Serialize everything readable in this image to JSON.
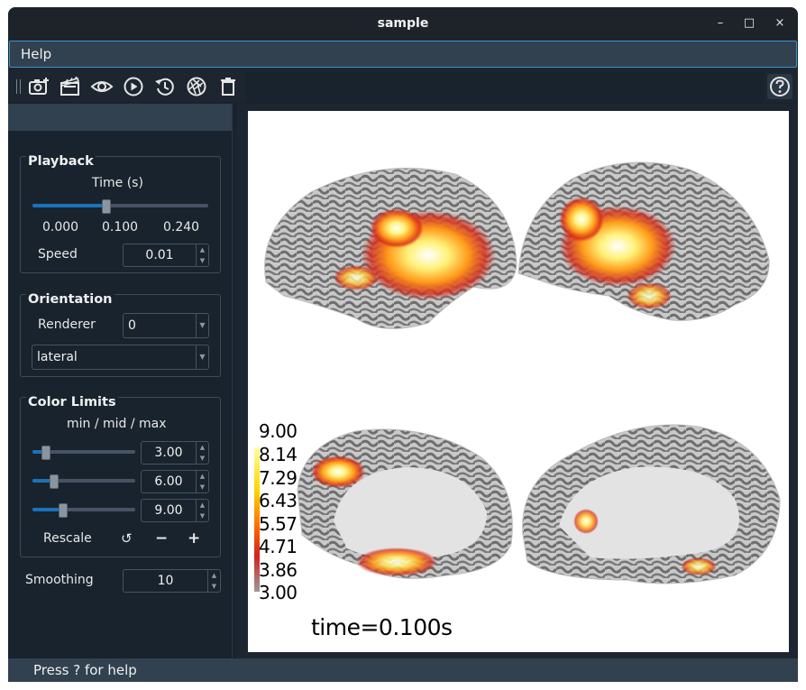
{
  "window": {
    "title": "sample",
    "controls": [
      "minimize",
      "maximize",
      "close"
    ]
  },
  "menu": {
    "help": "Help"
  },
  "toolbar": {
    "icons": [
      "screenshot-icon",
      "movie-icon",
      "visibility-icon",
      "play-icon",
      "reset-icon",
      "aperture-icon",
      "trash-icon",
      "help-icon"
    ]
  },
  "playback": {
    "title": "Playback",
    "time_label": "Time (s)",
    "time_value": 0.1,
    "ticks": [
      "0.000",
      "0.100",
      "0.240"
    ],
    "speed_label": "Speed",
    "speed": "0.01"
  },
  "orientation": {
    "title": "Orientation",
    "renderer_label": "Renderer",
    "renderer": "0",
    "view": "lateral"
  },
  "color_limits": {
    "title": "Color Limits",
    "subtitle": "min / mid / max",
    "min": "3.00",
    "mid": "6.00",
    "max": "9.00",
    "rescale_label": "Rescale",
    "reset_glyph": "↺",
    "minus_glyph": "−",
    "plus_glyph": "+"
  },
  "smoothing": {
    "label": "Smoothing",
    "value": "10"
  },
  "viewer": {
    "colorbar_ticks": [
      "9.00",
      "8.14",
      "7.29",
      "6.43",
      "5.57",
      "4.71",
      "3.86",
      "3.00"
    ],
    "time_text": "time=0.100s"
  },
  "status": {
    "text": "Press ? for help"
  },
  "colors": {
    "accent": "#1a72bb",
    "panel": "#19232d",
    "header": "#32414f"
  }
}
